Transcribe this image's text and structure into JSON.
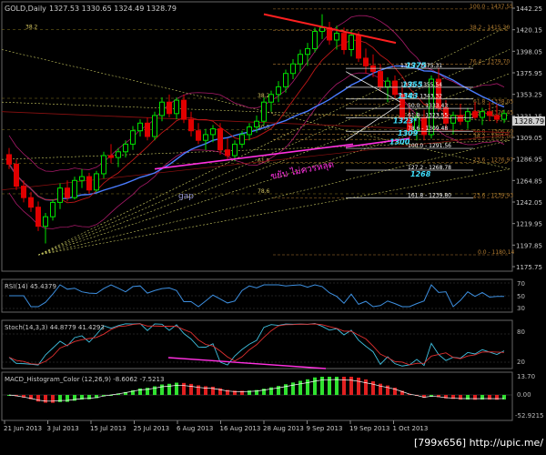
{
  "header": {
    "symbol": "GOLD,Daily",
    "ohlc": "1327.53 1330.65 1324.49 1328.79"
  },
  "price_axis": {
    "ticks": [
      "1442.25",
      "1420.15",
      "1398.05",
      "1375.95",
      "1353.25",
      "1331.15",
      "1309.05",
      "1286.95",
      "1264.85",
      "1242.05",
      "1219.95",
      "1197.85",
      "1175.75"
    ],
    "current": "1328.79"
  },
  "fib_labels": [
    {
      "text": "100.0 - 1437.55",
      "price": 1437.5,
      "x": 516,
      "color": "#b07a30"
    },
    {
      "text": "38.2 - 1415.30",
      "price": 1415.3,
      "x": 516,
      "color": "#b07a30"
    },
    {
      "text": "76.4 - 1379.70",
      "price": 1379.7,
      "x": 516,
      "color": "#b07a30"
    },
    {
      "text": "61.8 - 1338.05",
      "price": 1338.05,
      "x": 520,
      "color": "#b07a30"
    },
    {
      "text": "23.6 - 1326.45",
      "price": 1326.45,
      "x": 520,
      "color": "#b07a30"
    },
    {
      "text": "50.0 - 1306.60",
      "price": 1306.6,
      "x": 520,
      "color": "#b07a30"
    },
    {
      "text": "38.2 - 1301.00",
      "price": 1301.0,
      "x": 520,
      "color": "#b07a30"
    },
    {
      "text": "23.6 - 1276.97",
      "price": 1276.97,
      "x": 520,
      "color": "#b07a30"
    },
    {
      "text": "23.6 - 1239.93",
      "price": 1239.93,
      "x": 520,
      "color": "#b07a30"
    },
    {
      "text": "0.0 - 1180.14",
      "price": 1180.14,
      "x": 525,
      "color": "#b07a30"
    }
  ],
  "left_fib_labels": [
    {
      "text": "38.2",
      "price": 1416,
      "x": 28
    },
    {
      "text": "38.2",
      "price": 1344,
      "x": 283
    },
    {
      "text": "50.0",
      "price": 1311,
      "x": 283
    },
    {
      "text": "61.8",
      "price": 1276,
      "x": 283
    },
    {
      "text": "78.6",
      "price": 1244,
      "x": 283
    }
  ],
  "levels": [
    {
      "text": "1375 - 1375.31",
      "price": 1375.31,
      "x": 440,
      "color": "#ffffff"
    },
    {
      "text": "1355 - 1355.54",
      "price": 1355.54,
      "x": 440,
      "color": "#ffffff"
    },
    {
      "text": "1343 - 1343.32",
      "price": 1343.32,
      "x": 440,
      "color": "#ffffff"
    },
    {
      "text": "50.0 - 1333.43",
      "price": 1333.43,
      "x": 448,
      "color": "#ffffff"
    },
    {
      "text": "61.8 - 1323.55",
      "price": 1323.55,
      "x": 448,
      "color": "#ffffff"
    },
    {
      "text": "78.6 - 1309.48",
      "price": 1309.48,
      "x": 448,
      "color": "#ffffff"
    },
    {
      "text": "100.0 - 1291.56",
      "price": 1291.56,
      "x": 448,
      "color": "#ffffff"
    },
    {
      "text": "127.2 - 1268.78",
      "price": 1268.78,
      "x": 448,
      "color": "#ffffff"
    },
    {
      "text": "161.8 - 1239.80",
      "price": 1239.8,
      "x": 448,
      "color": "#ffffff"
    }
  ],
  "cyan_labels": [
    {
      "text": "1375",
      "price": 1376,
      "x": 446
    },
    {
      "text": "1355",
      "price": 1356,
      "x": 442
    },
    {
      "text": "1343",
      "price": 1344,
      "x": 437
    },
    {
      "text": "1323*",
      "price": 1318,
      "x": 432
    },
    {
      "text": "1309",
      "price": 1305,
      "x": 437
    },
    {
      "text": "1300",
      "price": 1296,
      "x": 428
    },
    {
      "text": "1268",
      "price": 1262,
      "x": 451
    }
  ],
  "annotations": {
    "gap": "gap",
    "thai_text": "ขยับ ไม่ควรหลุด"
  },
  "rsi": {
    "label": "RSI(14) 45.4379",
    "ticks": [
      "70",
      "50",
      "30"
    ]
  },
  "stoch": {
    "label": "Stoch(14,3,3) 44.8779 41.4293",
    "ticks": [
      "80",
      "20"
    ]
  },
  "macd": {
    "label": "MACD_Histogram_Color (12,26,9) -8.6062 -7.5213",
    "ticks": [
      "13.70",
      "0.00",
      "-52.9215"
    ]
  },
  "time_axis": [
    "21 Jun 2013",
    "3 Jul 2013",
    "15 Jul 2013",
    "25 Jul 2013",
    "6 Aug 2013",
    "16 Aug 2013",
    "28 Aug 2013",
    "9 Sep 2013",
    "19 Sep 2013",
    "1 Oct 2013"
  ],
  "watermark": "[799x656] http://upic.me/",
  "colors": {
    "up": "#00e000",
    "down": "#e00000",
    "ma_blue": "#4a7cff",
    "ma_red": "#c01818",
    "envelope": "#aa1a6a",
    "fib": "#b07a30",
    "magenta": "#ff30e0",
    "cyan": "#40e0ff",
    "level": "#ffffff",
    "dots": "#d8d878"
  },
  "chart_data": {
    "type": "candlestick",
    "title": "GOLD,Daily",
    "ylim": [
      1163,
      1445
    ],
    "candles": [
      [
        1285,
        1292,
        1270,
        1275
      ],
      [
        1275,
        1280,
        1248,
        1252
      ],
      [
        1252,
        1258,
        1235,
        1240
      ],
      [
        1240,
        1246,
        1225,
        1230
      ],
      [
        1230,
        1236,
        1205,
        1210
      ],
      [
        1210,
        1224,
        1192,
        1220
      ],
      [
        1220,
        1238,
        1216,
        1235
      ],
      [
        1235,
        1255,
        1228,
        1250
      ],
      [
        1250,
        1258,
        1236,
        1240
      ],
      [
        1240,
        1262,
        1238,
        1258
      ],
      [
        1258,
        1270,
        1250,
        1262
      ],
      [
        1262,
        1266,
        1244,
        1248
      ],
      [
        1248,
        1268,
        1246,
        1265
      ],
      [
        1265,
        1288,
        1260,
        1284
      ],
      [
        1284,
        1296,
        1276,
        1282
      ],
      [
        1282,
        1292,
        1272,
        1288
      ],
      [
        1288,
        1300,
        1282,
        1296
      ],
      [
        1296,
        1315,
        1290,
        1310
      ],
      [
        1310,
        1322,
        1304,
        1318
      ],
      [
        1318,
        1324,
        1300,
        1304
      ],
      [
        1304,
        1330,
        1300,
        1326
      ],
      [
        1326,
        1345,
        1320,
        1340
      ],
      [
        1340,
        1348,
        1324,
        1328
      ],
      [
        1328,
        1345,
        1322,
        1342
      ],
      [
        1342,
        1348,
        1318,
        1322
      ],
      [
        1322,
        1330,
        1304,
        1310
      ],
      [
        1310,
        1318,
        1296,
        1300
      ],
      [
        1300,
        1312,
        1290,
        1306
      ],
      [
        1306,
        1316,
        1298,
        1312
      ],
      [
        1312,
        1318,
        1285,
        1290
      ],
      [
        1290,
        1302,
        1280,
        1284
      ],
      [
        1284,
        1300,
        1278,
        1296
      ],
      [
        1296,
        1310,
        1292,
        1306
      ],
      [
        1306,
        1318,
        1300,
        1314
      ],
      [
        1314,
        1326,
        1308,
        1320
      ],
      [
        1320,
        1345,
        1316,
        1340
      ],
      [
        1340,
        1352,
        1330,
        1348
      ],
      [
        1348,
        1362,
        1340,
        1356
      ],
      [
        1356,
        1374,
        1350,
        1370
      ],
      [
        1370,
        1385,
        1364,
        1380
      ],
      [
        1380,
        1395,
        1372,
        1390
      ],
      [
        1390,
        1402,
        1378,
        1396
      ],
      [
        1396,
        1418,
        1392,
        1414
      ],
      [
        1414,
        1432,
        1406,
        1418
      ],
      [
        1418,
        1424,
        1400,
        1405
      ],
      [
        1405,
        1420,
        1395,
        1412
      ],
      [
        1412,
        1418,
        1390,
        1395
      ],
      [
        1395,
        1415,
        1388,
        1410
      ],
      [
        1410,
        1414,
        1382,
        1386
      ],
      [
        1386,
        1396,
        1370,
        1378
      ],
      [
        1378,
        1390,
        1366,
        1372
      ],
      [
        1372,
        1380,
        1352,
        1356
      ],
      [
        1356,
        1366,
        1340,
        1362
      ],
      [
        1362,
        1368,
        1344,
        1348
      ],
      [
        1348,
        1356,
        1318,
        1322
      ],
      [
        1322,
        1334,
        1302,
        1310
      ],
      [
        1310,
        1330,
        1300,
        1324
      ],
      [
        1324,
        1332,
        1300,
        1306
      ],
      [
        1306,
        1368,
        1302,
        1364
      ],
      [
        1364,
        1376,
        1330,
        1334
      ],
      [
        1334,
        1342,
        1312,
        1318
      ],
      [
        1318,
        1330,
        1306,
        1326
      ],
      [
        1326,
        1338,
        1316,
        1320
      ],
      [
        1320,
        1334,
        1312,
        1330
      ],
      [
        1330,
        1340,
        1322,
        1324
      ],
      [
        1324,
        1334,
        1316,
        1330
      ],
      [
        1330,
        1340,
        1320,
        1326
      ],
      [
        1326,
        1338,
        1318,
        1322
      ],
      [
        1322,
        1332,
        1318,
        1328
      ]
    ]
  }
}
